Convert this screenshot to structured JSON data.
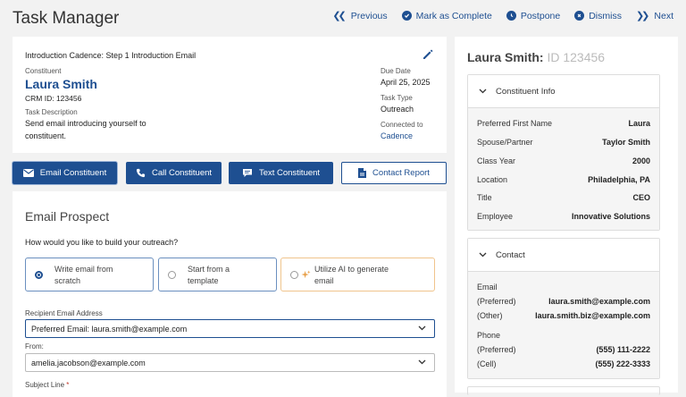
{
  "app": {
    "title": "Task Manager"
  },
  "nav": {
    "previous": "Previous",
    "complete": "Mark as Complete",
    "postpone": "Postpone",
    "dismiss": "Dismiss",
    "next": "Next"
  },
  "task": {
    "cadence_title": "Introduction Cadence: Step 1 Introduction Email",
    "constituent_label": "Constituent",
    "constituent_name": "Laura Smith",
    "crm_id": "CRM ID: 123456",
    "desc_label": "Task Description",
    "desc_line1": "Send email introducing yourself to",
    "desc_line2": "constituent.",
    "due_label": "Due Date",
    "due_value": "April 25, 2025",
    "type_label": "Task Type",
    "type_value": "Outreach",
    "connected_label": "Connected to",
    "connected_value": "Cadence"
  },
  "actions": {
    "email": "Email Constituent",
    "call": "Call Constituent",
    "text": "Text Constituent",
    "report": "Contact Report"
  },
  "email": {
    "title": "Email Prospect",
    "question": "How would you like to build your outreach?",
    "options": [
      {
        "line1": "Write email from",
        "line2": "scratch",
        "selected": true
      },
      {
        "line1": "Start from a",
        "line2": "template",
        "selected": false
      },
      {
        "line1": "Utilize AI to generate",
        "line2": "email",
        "selected": false
      }
    ],
    "recipient_label": "Recipient Email Address",
    "recipient_value": "Preferred Email: laura.smith@example.com",
    "from_label": "From:",
    "from_value": "amelia.jacobson@example.com",
    "subject_label": "Subject Line",
    "required_mark": "*"
  },
  "sidebar": {
    "name": "Laura Smith:",
    "id": "ID 123456",
    "constituent_info": {
      "title": "Constituent Info",
      "rows": [
        {
          "k": "Preferred First Name",
          "v": "Laura"
        },
        {
          "k": "Spouse/Partner",
          "v": "Taylor Smith"
        },
        {
          "k": "Class Year",
          "v": "2000"
        },
        {
          "k": "Location",
          "v": "Philadelphia, PA"
        },
        {
          "k": "Title",
          "v": "CEO"
        },
        {
          "k": "Employee",
          "v": "Innovative Solutions"
        }
      ]
    },
    "contact": {
      "title": "Contact",
      "email_label": "Email",
      "email_pref_label": "(Preferred)",
      "email_pref": "laura.smith@example.com",
      "email_other_label": "(Other)",
      "email_other": "laura.smith.biz@example.com",
      "phone_label": "Phone",
      "phone_pref_label": "(Preferred)",
      "phone_pref": "(555) 111-2222",
      "phone_cell_label": "(Cell)",
      "phone_cell": "(555) 222-3333"
    }
  },
  "colors": {
    "primary": "#1e4f91",
    "ai_accent": "#e8a04a",
    "background": "#f2f2f2"
  }
}
